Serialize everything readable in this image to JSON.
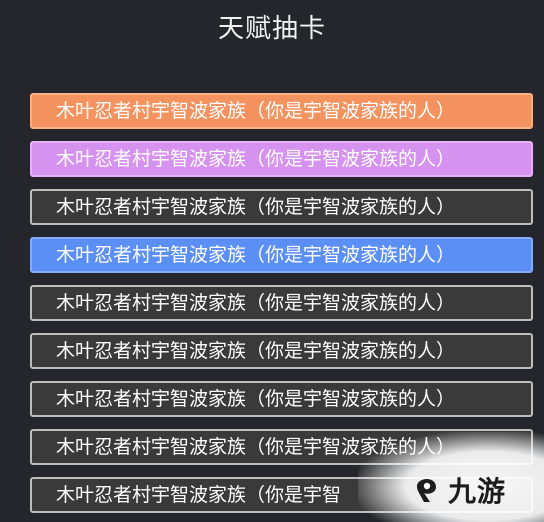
{
  "title": "天赋抽卡",
  "cards": [
    {
      "label": "木叶忍者村宇智波家族（你是宇智波家族的人）",
      "style": "orange"
    },
    {
      "label": "木叶忍者村宇智波家族（你是宇智波家族的人）",
      "style": "purple"
    },
    {
      "label": "木叶忍者村宇智波家族（你是宇智波家族的人）",
      "style": "dark"
    },
    {
      "label": "木叶忍者村宇智波家族（你是宇智波家族的人）",
      "style": "blue"
    },
    {
      "label": "木叶忍者村宇智波家族（你是宇智波家族的人）",
      "style": "dark"
    },
    {
      "label": "木叶忍者村宇智波家族（你是宇智波家族的人）",
      "style": "dark"
    },
    {
      "label": "木叶忍者村宇智波家族（你是宇智波家族的人）",
      "style": "dark"
    },
    {
      "label": "木叶忍者村宇智波家族（你是宇智波家族的人）",
      "style": "dark"
    },
    {
      "label": "木叶忍者村宇智波家族（你是宇智",
      "style": "dark"
    }
  ],
  "colors": {
    "background": "#24262b",
    "orange": "#f4935f",
    "purple": "#d592ee",
    "blue": "#5c8ff6",
    "dark": "#3a3a3a"
  },
  "watermark": {
    "text": "九游",
    "icon": "jiuyou-logo-icon"
  }
}
